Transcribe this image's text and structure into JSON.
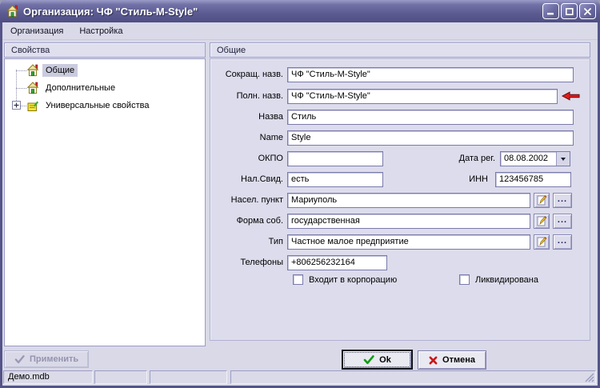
{
  "window": {
    "title": "Организация: ЧФ \"Стиль-M-Style\""
  },
  "menu": {
    "items": [
      {
        "label": "Организация"
      },
      {
        "label": "Настройка"
      }
    ]
  },
  "sidebar": {
    "header": "Свойства",
    "items": [
      {
        "label": "Общие",
        "selected": true
      },
      {
        "label": "Дополнительные",
        "selected": false
      },
      {
        "label": "Универсальные свойства",
        "selected": false,
        "expandable": true
      }
    ]
  },
  "form": {
    "header": "Общие",
    "short_name": {
      "label": "Сокращ. назв.",
      "value": "ЧФ \"Стиль-M-Style\""
    },
    "full_name": {
      "label": "Полн. назв.",
      "value": "ЧФ \"Стиль-M-Style\""
    },
    "nazva": {
      "label": "Назва",
      "value": "Стиль"
    },
    "name": {
      "label": "Name",
      "value": "Style"
    },
    "okpo": {
      "label": "ОКПО",
      "value": ""
    },
    "reg_date": {
      "label": "Дата рег.",
      "value": "08.08.2002"
    },
    "tax_cert": {
      "label": "Нал.Свид.",
      "value": "есть"
    },
    "inn": {
      "label": "ИНН",
      "value": "123456785"
    },
    "city": {
      "label": "Насел. пункт",
      "value": "Мариуполь"
    },
    "ownership": {
      "label": "Форма соб.",
      "value": "государственная"
    },
    "org_type": {
      "label": "Тип",
      "value": "Частное малое предприятие"
    },
    "phones": {
      "label": "Телефоны",
      "value": "+806256232164"
    },
    "in_corporation": {
      "label": "Входит в корпорацию",
      "checked": false
    },
    "liquidated": {
      "label": "Ликвидирована",
      "checked": false
    },
    "dots_label": "..."
  },
  "buttons": {
    "apply": "Применить",
    "ok": "Ok",
    "cancel": "Отмена"
  },
  "statusbar": {
    "db_file": "Демо.mdb"
  },
  "colors": {
    "titlebar": "#5b5b92",
    "panel_bg": "#dcdcec",
    "ok_check": "#119c11",
    "cancel_cross": "#cc1414",
    "arrow_red": "#e11c1c"
  }
}
